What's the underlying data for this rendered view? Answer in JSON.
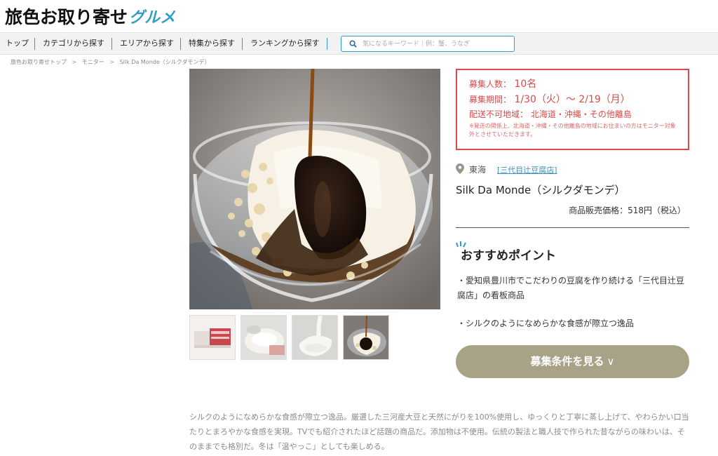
{
  "site": {
    "logo_main": "旅色お取り寄せ",
    "logo_accent": "グルメ"
  },
  "nav": {
    "items": [
      {
        "label": "トップ"
      },
      {
        "label": "カテゴリから探す"
      },
      {
        "label": "エリアから探す"
      },
      {
        "label": "特集から探す"
      },
      {
        "label": "ランキングから探す"
      }
    ],
    "search_placeholder": "気になるキーワード｜例：蟹、うなぎ"
  },
  "breadcrumb": [
    "旅色お取り寄せトップ",
    "モニター",
    "Silk Da Monde（シルクダモンデ）"
  ],
  "breadcrumb_sep": ">",
  "recruit": {
    "count_label": "募集人数：",
    "count_value": "10名",
    "period_label": "募集期間：",
    "period_value": "1/30（火）～ 2/19（月）",
    "no_delivery_label": "配送不可地域：",
    "no_delivery_value": "北海道・沖縄・その他離島",
    "note": "※発送の関係上、北海道・沖縄・その他離島の地域にお住まいの方はモニター対象外とさせていただきます。"
  },
  "product": {
    "area": "東海",
    "shop": "[三代目辻豆腐店]",
    "title": "Silk Da Monde（シルクダモンデ）",
    "price": "商品販売価格：518円（税込）"
  },
  "recommend": {
    "title": "おすすめポイント",
    "points": [
      "・愛知県豊川市でこだわりの豆腐を作り続ける「三代目辻豆腐店」の看板商品",
      "・シルクのようになめらかな食感が際立つ逸品"
    ]
  },
  "cta": {
    "label": "募集条件を見る",
    "chevron": "∨"
  },
  "description": "シルクのようになめらかな食感が際立つ逸品。厳選した三河産大豆と天然にがりを100%使用し、ゆっくりと丁寧に蒸し上げて、やわらかい口当たりとまろやかな食感を実現。TVでも紹介されたほど話題の商品だ。添加物は不使用。伝統の製法と職人技で作られた昔ながらの味わいは、そのままでも格別だ。冬は「温やっこ」としても楽しめる。",
  "colors": {
    "accent_blue": "#2f9ec4",
    "alert_red": "#d94a4a",
    "cta_bg": "#a8a287"
  }
}
